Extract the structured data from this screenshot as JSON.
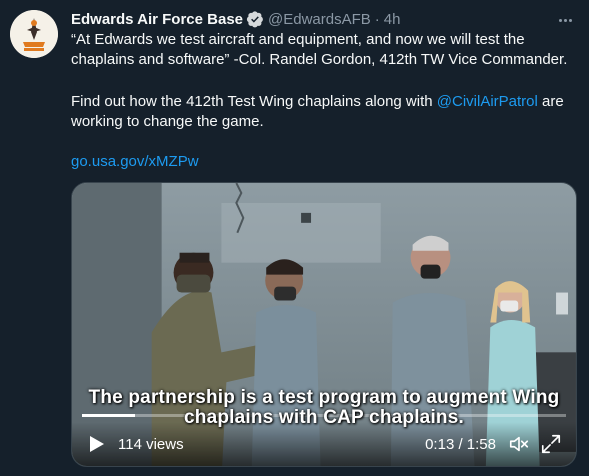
{
  "tweet": {
    "author_name": "Edwards Air Force Base",
    "handle": "@EdwardsAFB",
    "separator": "·",
    "time": "4h",
    "text_line1": "“At Edwards we test aircraft and equipment, and now we will test the",
    "text_line2": "chaplains and software” -Col. Randel Gordon, 412th TW Vice Commander.",
    "text_line3_before": "Find out how the 412th Test Wing chaplains along with ",
    "text_line3_mention": "@CivilAirPatrol",
    "text_line3_after": " are",
    "text_line4": "working to change the game.",
    "link": "go.usa.gov/xMZPw"
  },
  "video": {
    "caption_line1": "The partnership is a test program to augment Wing",
    "caption_line2": "chaplains with CAP chaplains.",
    "views": "114 views",
    "timecode": "0:13 / 1:58",
    "progress": 0.11
  },
  "icons": {
    "avatar": "edwards-afb-logo",
    "verified": "verified-badge-icon",
    "more": "more-options-icon",
    "play": "play-icon",
    "mute": "muted-speaker-icon",
    "expand": "fullscreen-expand-icon"
  },
  "colors": {
    "background": "#15202b",
    "link": "#1d9bf0",
    "secondary_text": "#8b98a5"
  }
}
